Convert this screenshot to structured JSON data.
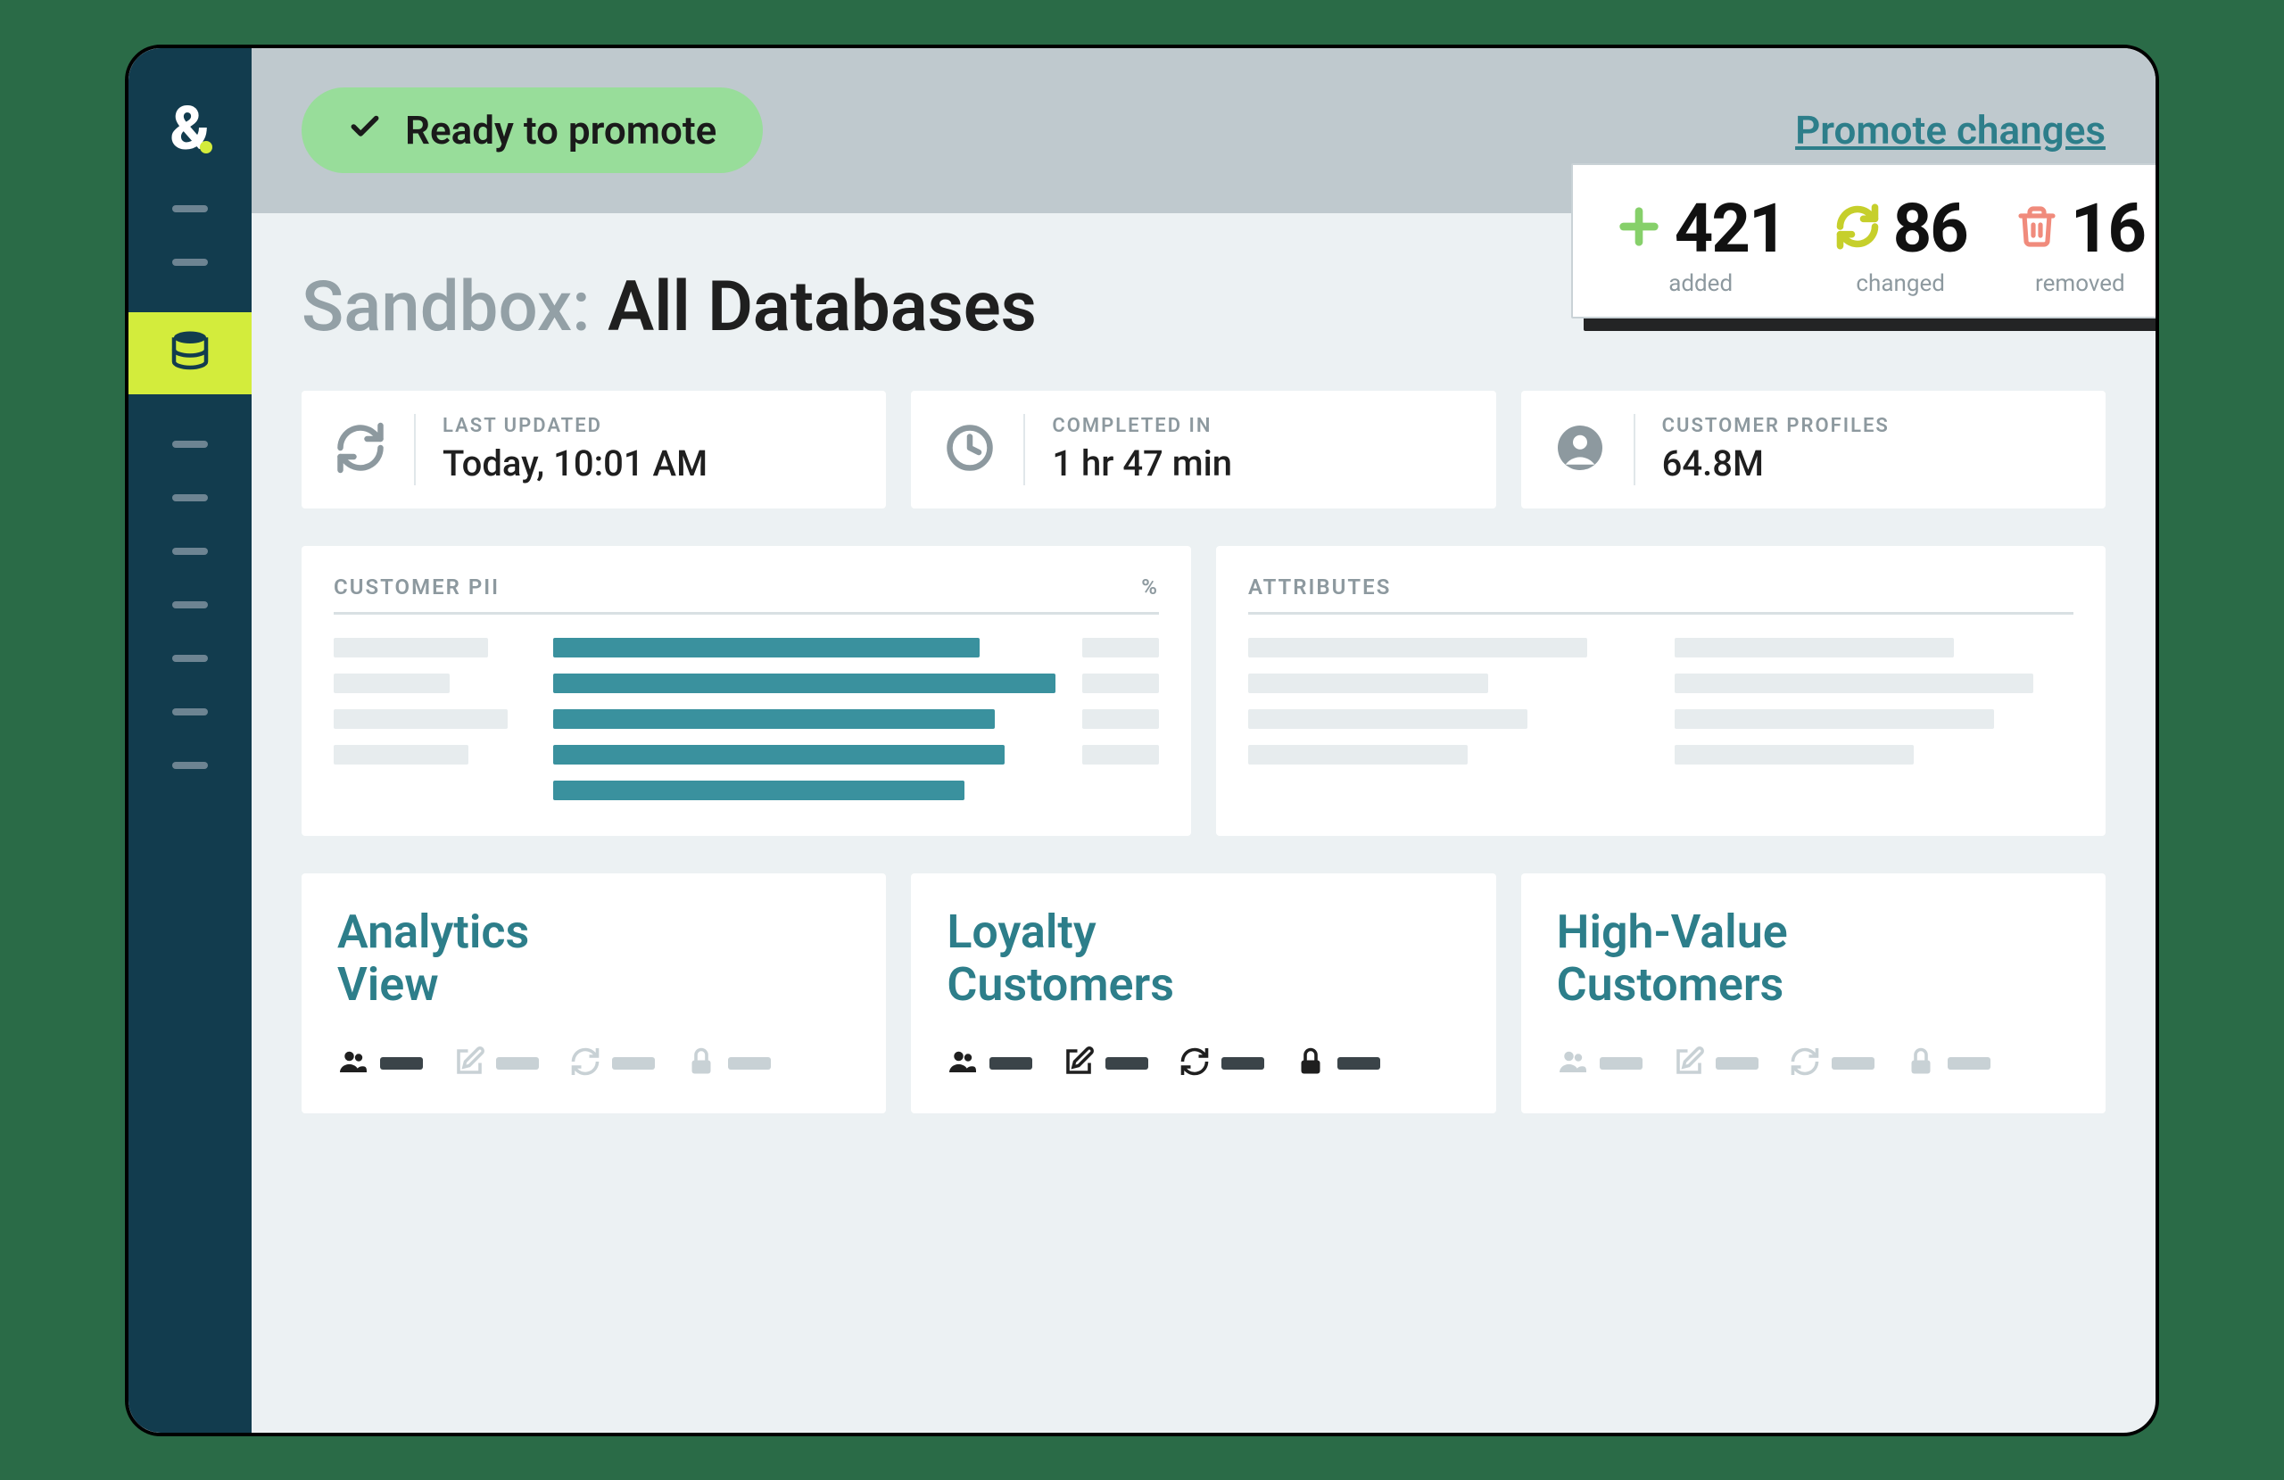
{
  "status": {
    "label": "Ready to promote"
  },
  "promote_link": "Promote changes",
  "title": {
    "prefix": "Sandbox:",
    "name": "All Databases"
  },
  "stats": {
    "last_updated": {
      "label": "LAST UPDATED",
      "value": "Today, 10:01 AM"
    },
    "completed_in": {
      "label": "COMPLETED IN",
      "value": "1 hr 47 min"
    },
    "customer_profiles": {
      "label": "CUSTOMER PROFILES",
      "value": "64.8M"
    }
  },
  "panels": {
    "pii": {
      "title": "CUSTOMER PII",
      "pct_label": "%"
    },
    "attributes": {
      "title": "ATTRIBUTES"
    }
  },
  "cards": [
    {
      "title_l1": "Analytics",
      "title_l2": "View",
      "variant": "muted"
    },
    {
      "title_l1": "Loyalty",
      "title_l2": "Customers",
      "variant": "dark"
    },
    {
      "title_l1": "High-Value",
      "title_l2": "Customers",
      "variant": "muted"
    }
  ],
  "changes": {
    "added": {
      "value": "421",
      "label": "added"
    },
    "changed": {
      "value": "86",
      "label": "changed"
    },
    "removed": {
      "value": "16",
      "label": "removed"
    }
  },
  "colors": {
    "accent": "#d3ec3c",
    "teal": "#2d7e8a",
    "green_pill": "#98dd9a",
    "add_icon": "#86d06a",
    "changed_icon": "#c6cf2b",
    "removed_icon": "#f08b7c"
  }
}
